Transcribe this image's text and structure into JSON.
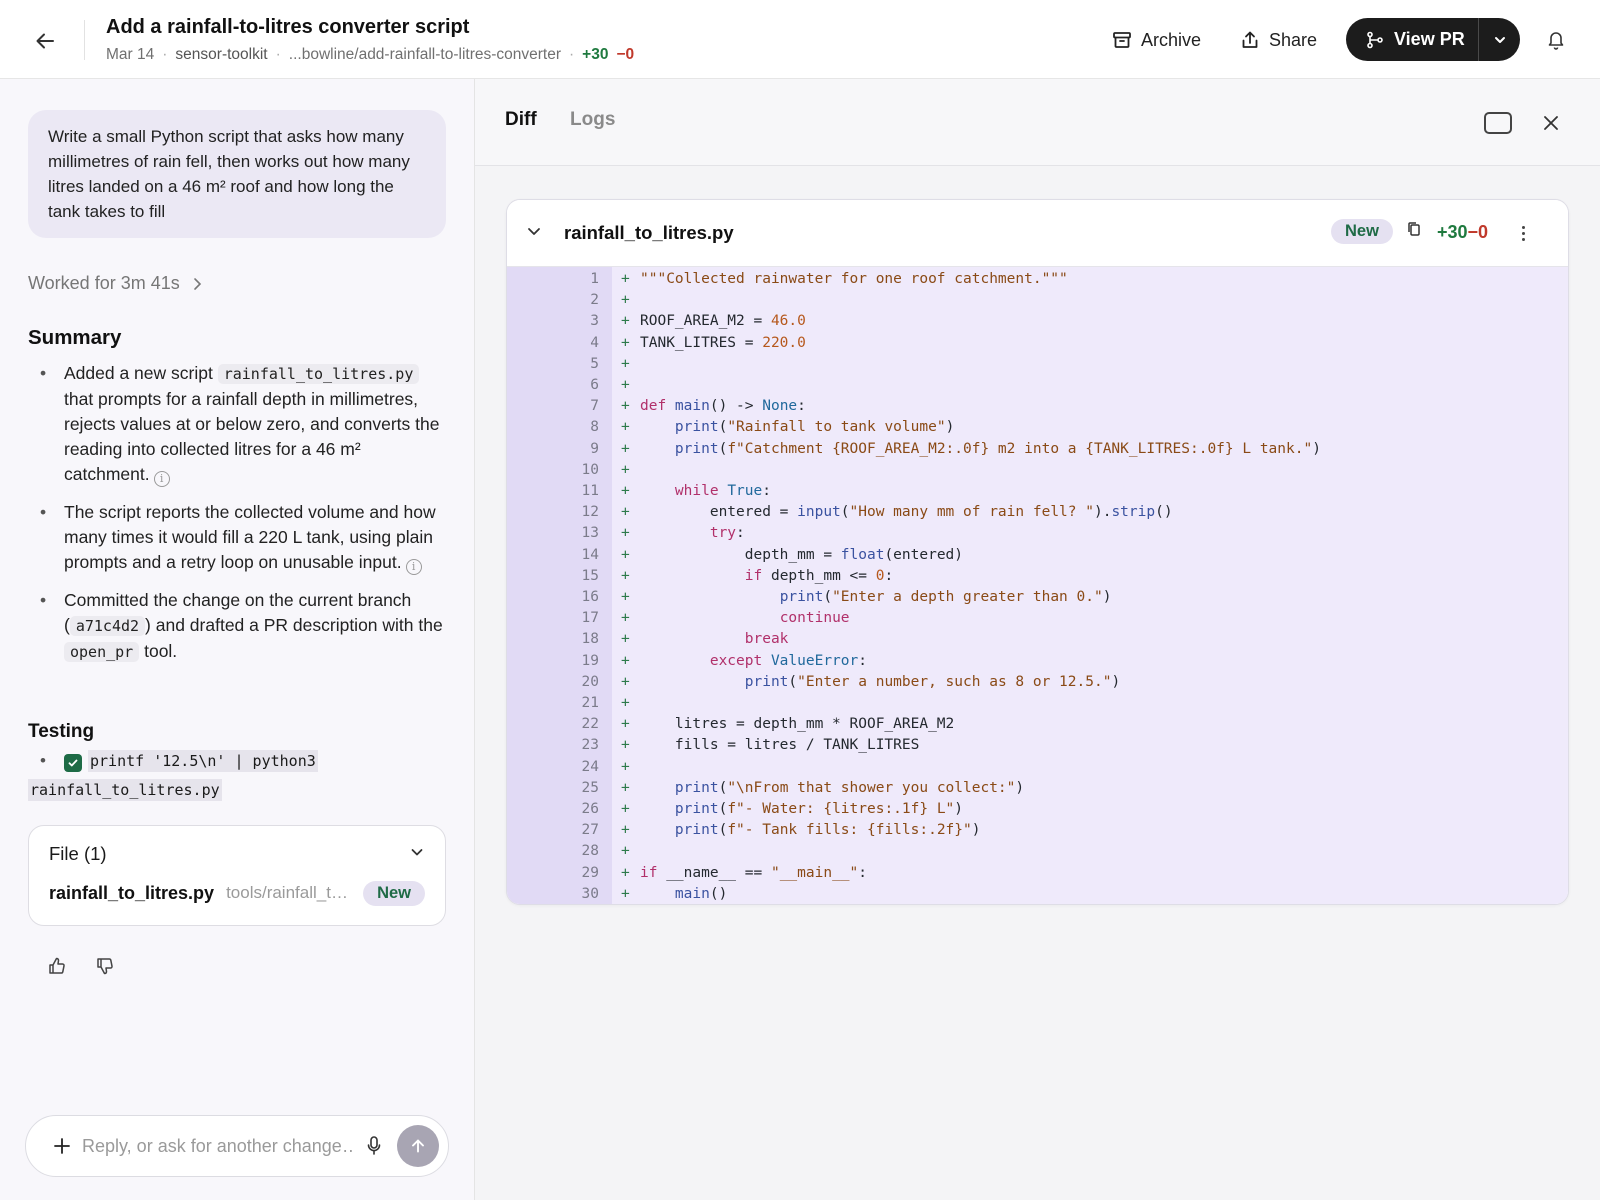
{
  "header": {
    "title": "Add a rainfall-to-litres converter script",
    "date": "Mar 14",
    "repo": "sensor-toolkit",
    "branch": "...bowline/add-rainfall-to-litres-converter",
    "additions": "+30",
    "deletions": "−0",
    "archive_label": "Archive",
    "share_label": "Share",
    "view_pr_label": "View PR"
  },
  "left": {
    "prompt": "Write a small Python script that asks how many millimetres of rain fell, then works out how many litres landed on a 46 m² roof and how long the tank takes to fill",
    "worked_for": "Worked for 3m 41s",
    "summary_title": "Summary",
    "bullets": [
      {
        "pre": "Added a new script",
        "code": "rainfall_to_litres.py",
        "post": "that prompts for a rainfall depth in millimetres, rejects values at or below zero, and converts the reading into collected litres for a 46 m² catchment."
      },
      {
        "text": "The script reports the collected volume and how many times it would fill a 220 L tank, using plain prompts and a retry loop on unusable input."
      },
      {
        "pre": "Committed the change on the current branch (",
        "code": "a71c4d2",
        "mid": ") and drafted a PR description with the",
        "code2": "open_pr",
        "post": "tool."
      }
    ],
    "testing_title": "Testing",
    "test_cmd_1": "printf '12.5\\n' | python3",
    "test_cmd_2": "rainfall_to_litres.py",
    "files_header": "File (1)",
    "file_name": "rainfall_to_litres.py",
    "file_path": "tools/rainfall_to_litres.py",
    "file_badge": "New",
    "reply_placeholder": "Reply, or ask for another change…"
  },
  "right": {
    "tab_diff": "Diff",
    "tab_logs": "Logs",
    "file_name": "rainfall_to_litres.py",
    "badge": "New",
    "additions": "+30",
    "deletions": "−0",
    "lines": [
      [
        [
          "str",
          "\"\"\"Collected rainwater for one roof catchment.\"\"\""
        ]
      ],
      [],
      [
        [
          "",
          "ROOF_AREA_M2 = "
        ],
        [
          "num",
          "46.0"
        ]
      ],
      [
        [
          "",
          "TANK_LITRES = "
        ],
        [
          "num",
          "220.0"
        ]
      ],
      [],
      [],
      [
        [
          "kw",
          "def "
        ],
        [
          "fn",
          "main"
        ],
        [
          "",
          "() -> "
        ],
        [
          "bi",
          "None"
        ],
        [
          "",
          ":"
        ]
      ],
      [
        [
          "",
          "    "
        ],
        [
          "fn",
          "print"
        ],
        [
          "",
          "("
        ],
        [
          "str",
          "\"Rainfall to tank volume\""
        ],
        [
          "",
          ")"
        ]
      ],
      [
        [
          "",
          "    "
        ],
        [
          "fn",
          "print"
        ],
        [
          "",
          "("
        ],
        [
          "str",
          "f\"Catchment {ROOF_AREA_M2:.0f} m2 into a {TANK_LITRES:.0f} L tank.\""
        ],
        [
          "",
          ")"
        ]
      ],
      [],
      [
        [
          "",
          "    "
        ],
        [
          "kw",
          "while "
        ],
        [
          "bi",
          "True"
        ],
        [
          "",
          ":"
        ]
      ],
      [
        [
          "",
          "        entered = "
        ],
        [
          "fn",
          "input"
        ],
        [
          "",
          "("
        ],
        [
          "str",
          "\"How many mm of rain fell? \""
        ],
        [
          "",
          ")."
        ],
        [
          "fn",
          "strip"
        ],
        [
          "",
          "()"
        ]
      ],
      [
        [
          "",
          "        "
        ],
        [
          "kw",
          "try"
        ],
        [
          "",
          ":"
        ]
      ],
      [
        [
          "",
          "            depth_mm = "
        ],
        [
          "fn",
          "float"
        ],
        [
          "",
          "(entered)"
        ]
      ],
      [
        [
          "",
          "            "
        ],
        [
          "kw",
          "if "
        ],
        [
          "",
          "depth_mm <= "
        ],
        [
          "num",
          "0"
        ],
        [
          "",
          ":"
        ]
      ],
      [
        [
          "",
          "                "
        ],
        [
          "fn",
          "print"
        ],
        [
          "",
          "("
        ],
        [
          "str",
          "\"Enter a depth greater than 0.\""
        ],
        [
          "",
          ")"
        ]
      ],
      [
        [
          "",
          "                "
        ],
        [
          "kw",
          "continue"
        ]
      ],
      [
        [
          "",
          "            "
        ],
        [
          "kw",
          "break"
        ]
      ],
      [
        [
          "",
          "        "
        ],
        [
          "kw",
          "except "
        ],
        [
          "bi",
          "ValueError"
        ],
        [
          "",
          ":"
        ]
      ],
      [
        [
          "",
          "            "
        ],
        [
          "fn",
          "print"
        ],
        [
          "",
          "("
        ],
        [
          "str",
          "\"Enter a number, such as 8 or 12.5.\""
        ],
        [
          "",
          ")"
        ]
      ],
      [],
      [
        [
          "",
          "    litres = depth_mm * ROOF_AREA_M2"
        ]
      ],
      [
        [
          "",
          "    fills = litres / TANK_LITRES"
        ]
      ],
      [],
      [
        [
          "",
          "    "
        ],
        [
          "fn",
          "print"
        ],
        [
          "",
          "("
        ],
        [
          "str",
          "\"\\nFrom that shower you collect:\""
        ],
        [
          "",
          ")"
        ]
      ],
      [
        [
          "",
          "    "
        ],
        [
          "fn",
          "print"
        ],
        [
          "",
          "("
        ],
        [
          "str",
          "f\"- Water: {litres:.1f} L\""
        ],
        [
          "",
          ")"
        ]
      ],
      [
        [
          "",
          "    "
        ],
        [
          "fn",
          "print"
        ],
        [
          "",
          "("
        ],
        [
          "str",
          "f\"- Tank fills: {fills:.2f}\""
        ],
        [
          "",
          ")"
        ]
      ],
      [],
      [
        [
          "kw",
          "if "
        ],
        [
          "",
          "__name__ == "
        ],
        [
          "str",
          "\"__main__\""
        ],
        [
          "",
          ":"
        ]
      ],
      [
        [
          "",
          "    "
        ],
        [
          "fn",
          "main"
        ],
        [
          "",
          "()"
        ]
      ]
    ]
  },
  "icons": {
    "back": "arrow-left-icon",
    "archive": "archive-box-icon",
    "share": "share-upload-icon",
    "branch": "git-branch-icon",
    "bell": "bell-icon",
    "copy": "copy-icon",
    "more": "more-vertical-icon"
  }
}
